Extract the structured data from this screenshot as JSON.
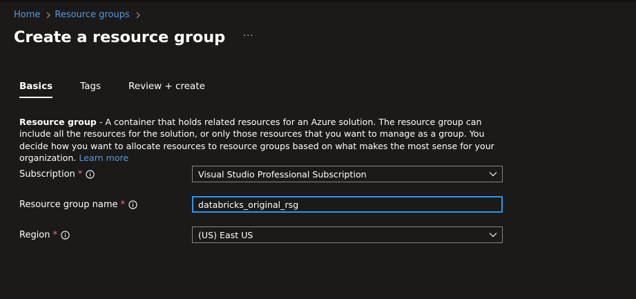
{
  "breadcrumb": {
    "items": [
      {
        "label": "Home"
      },
      {
        "label": "Resource groups"
      }
    ]
  },
  "page": {
    "title": "Create a resource group",
    "more_icon": "ellipsis-icon",
    "more_label": "···"
  },
  "tabs": [
    {
      "label": "Basics",
      "active": true
    },
    {
      "label": "Tags",
      "active": false
    },
    {
      "label": "Review + create",
      "active": false
    }
  ],
  "description": {
    "term": "Resource group",
    "text": " - A container that holds related resources for an Azure solution. The resource group can include all the resources for the solution, or only those resources that you want to manage as a group. You decide how you want to allocate resources to resource groups based on what makes the most sense for your organization.",
    "learn_more": "Learn more"
  },
  "form": {
    "subscription": {
      "label": "Subscription",
      "required_mark": "*",
      "value": "Visual Studio Professional Subscription"
    },
    "resource_group_name": {
      "label": "Resource group name",
      "required_mark": "*",
      "value": "databricks_original_rsg"
    },
    "region": {
      "label": "Region",
      "required_mark": "*",
      "value": "(US) East US"
    }
  },
  "colors": {
    "background": "#1b1a19",
    "link": "#4f9ce8",
    "required": "#f1707b",
    "focus_border": "#2899f5",
    "field_border": "#8a8886"
  }
}
